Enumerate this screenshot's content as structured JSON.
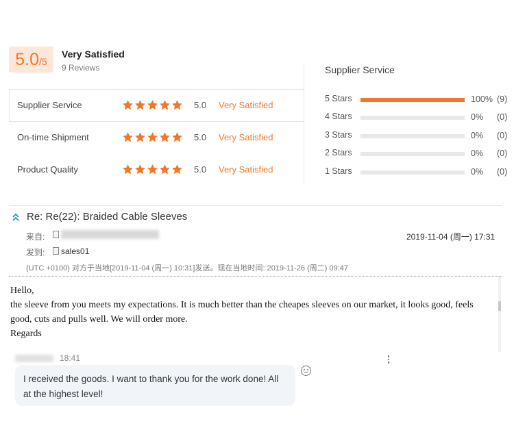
{
  "summary": {
    "score": "5.0",
    "score_denominator": "/5",
    "label": "Very Satisfied",
    "reviews": "9 Reviews"
  },
  "ratings": [
    {
      "label": "Supplier Service",
      "stars": 5,
      "score": "5.0",
      "text": "Very Satisfied"
    },
    {
      "label": "On-time Shipment",
      "stars": 5,
      "score": "5.0",
      "text": "Very Satisfied"
    },
    {
      "label": "Product Quality",
      "stars": 5,
      "score": "5.0",
      "text": "Very Satisfied"
    }
  ],
  "distribution": {
    "title": "Supplier Service",
    "rows": [
      {
        "label": "5 Stars",
        "fraction": 1.0,
        "pct": "100%",
        "count": "(9)"
      },
      {
        "label": "4 Stars",
        "fraction": 0,
        "pct": "0%",
        "count": "(0)"
      },
      {
        "label": "3 Stars",
        "fraction": 0,
        "pct": "0%",
        "count": "(0)"
      },
      {
        "label": "2 Stars",
        "fraction": 0,
        "pct": "0%",
        "count": "(0)"
      },
      {
        "label": "1 Stars",
        "fraction": 0,
        "pct": "0%",
        "count": "(0)"
      }
    ]
  },
  "email": {
    "subject": "Re: Re(22): Braided Cable Sleeves",
    "from_label": "来自:",
    "to_label": "发到:",
    "to_value": "sales01",
    "date": "2019-11-04 (周一) 17:31",
    "timezone_note": "(UTC +0100) 对方于当地[2019-11-04 (周一) 10:31]发送。现在当地时间: 2019-11-26 (周二) 09:47",
    "body": [
      "Hello,",
      "the sleeve from you meets my expectations. It is much better than the cheapes sleeves on our market, it looks good, feels good, cuts and pulls well. We will order more.",
      "Regards"
    ]
  },
  "chat": {
    "time": "18:41",
    "message": "I received the goods. I want to thank you for the work done! All at the highest level!"
  },
  "colors": {
    "accent": "#f0782a",
    "score_bg": "#fde7d9",
    "bar_bg": "#e8e8e8",
    "bubble_bg": "#f1f5f9",
    "toggle_icon": "#2a8fb0"
  },
  "icons": {
    "star": "star-icon",
    "toggle": "chevron-double-up-icon",
    "attachment": "contact-card-icon",
    "emoji": "smiley-icon",
    "more": "more-vertical-icon"
  }
}
